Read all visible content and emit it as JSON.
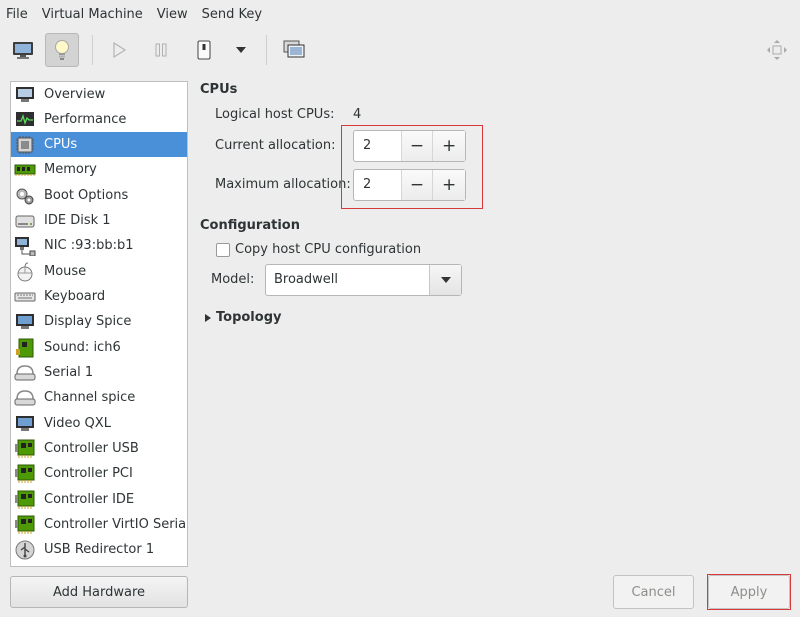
{
  "menubar": {
    "items": [
      "File",
      "Virtual Machine",
      "View",
      "Send Key"
    ]
  },
  "toolbar": {
    "buttons": [
      "monitor-icon",
      "lightbulb-icon",
      "play-icon",
      "pause-icon",
      "power-icon",
      "dropdown-arrow-icon",
      "snapshot-icon",
      "fullscreen-icon"
    ]
  },
  "sidebar": {
    "items": [
      {
        "label": "Overview",
        "icon": "overview-icon"
      },
      {
        "label": "Performance",
        "icon": "performance-icon"
      },
      {
        "label": "CPUs",
        "icon": "cpu-icon"
      },
      {
        "label": "Memory",
        "icon": "memory-icon"
      },
      {
        "label": "Boot Options",
        "icon": "boot-icon"
      },
      {
        "label": "IDE Disk 1",
        "icon": "disk-icon"
      },
      {
        "label": "NIC :93:bb:b1",
        "icon": "nic-icon"
      },
      {
        "label": "Mouse",
        "icon": "mouse-icon"
      },
      {
        "label": "Keyboard",
        "icon": "keyboard-icon"
      },
      {
        "label": "Display Spice",
        "icon": "display-icon"
      },
      {
        "label": "Sound: ich6",
        "icon": "sound-icon"
      },
      {
        "label": "Serial 1",
        "icon": "serial-icon"
      },
      {
        "label": "Channel spice",
        "icon": "channel-icon"
      },
      {
        "label": "Video QXL",
        "icon": "video-icon"
      },
      {
        "label": "Controller USB",
        "icon": "controller-icon"
      },
      {
        "label": "Controller PCI",
        "icon": "controller-icon"
      },
      {
        "label": "Controller IDE",
        "icon": "controller-icon"
      },
      {
        "label": "Controller VirtIO Serial",
        "icon": "controller-icon"
      },
      {
        "label": "USB Redirector 1",
        "icon": "usb-icon"
      }
    ],
    "selected": "CPUs",
    "add_hardware_label": "Add Hardware"
  },
  "cpus": {
    "title": "CPUs",
    "logical_label": "Logical host CPUs:",
    "logical_value": "4",
    "current_label": "Current allocation:",
    "current_value": "2",
    "maximum_label": "Maximum allocation:",
    "maximum_value": "2",
    "minus": "−",
    "plus": "+"
  },
  "configuration": {
    "title": "Configuration",
    "copy_host_label": "Copy host CPU configuration",
    "copy_host_checked": false,
    "model_label": "Model:",
    "model_value": "Broadwell"
  },
  "topology": {
    "label": "Topology",
    "expanded": false
  },
  "footer": {
    "cancel_label": "Cancel",
    "apply_label": "Apply"
  },
  "colors": {
    "selection": "#4a90d9",
    "highlight_box": "#d63a3a"
  }
}
